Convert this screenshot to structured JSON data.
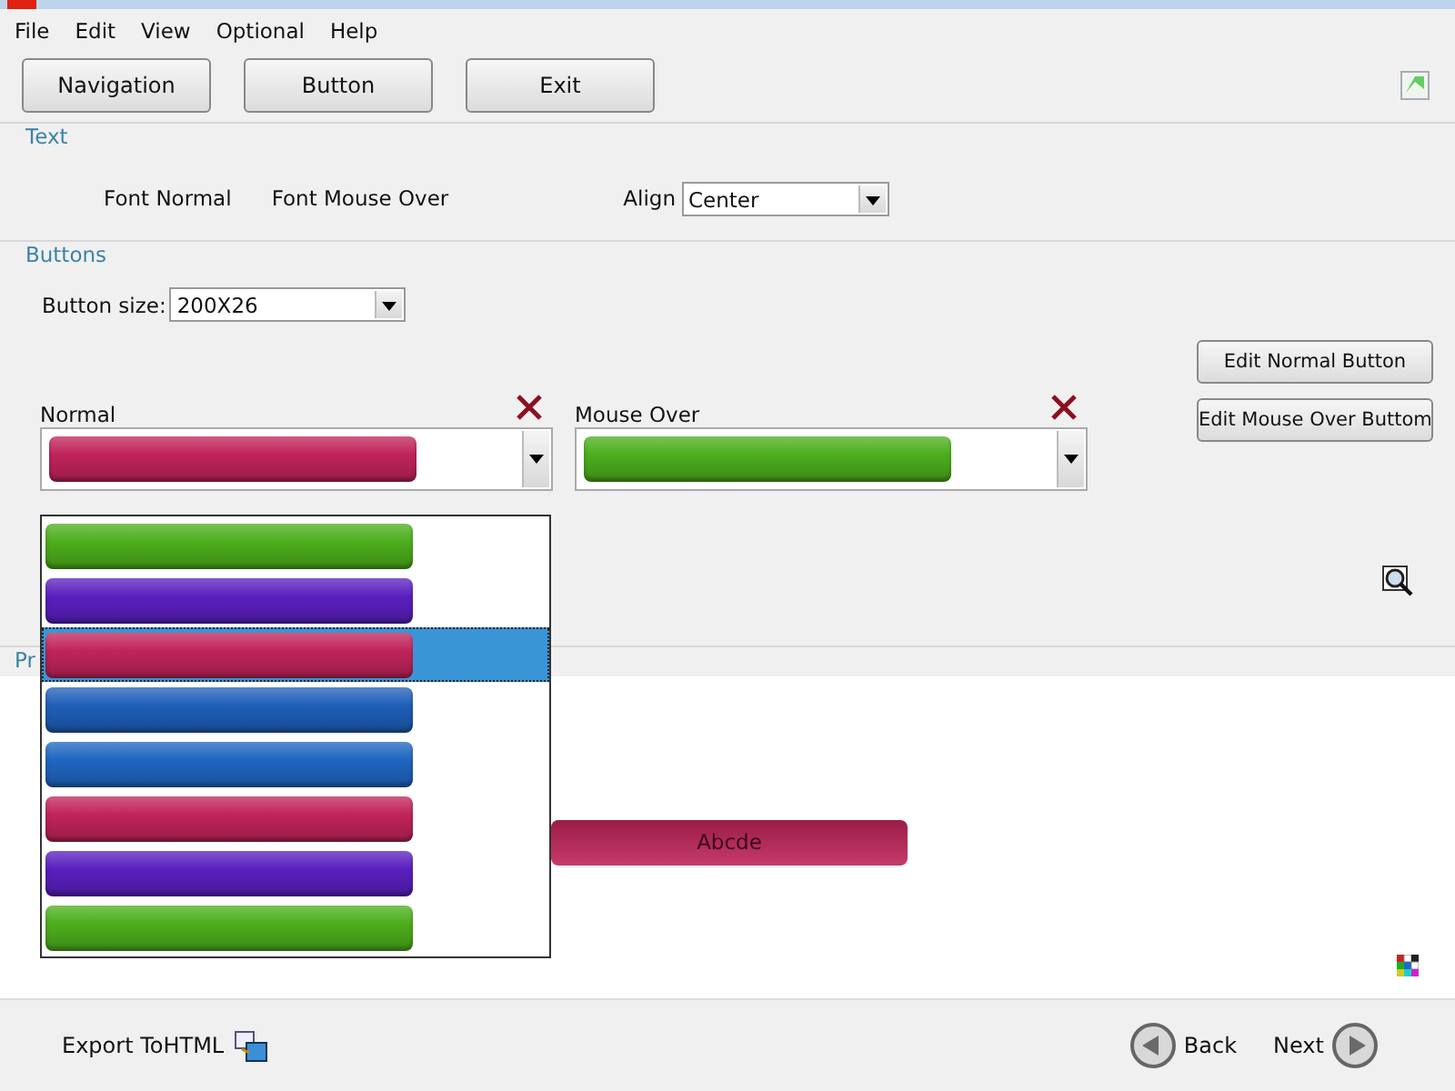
{
  "menu": [
    {
      "label": "File"
    },
    {
      "label": "Edit"
    },
    {
      "label": "View"
    },
    {
      "label": "Optional"
    },
    {
      "label": "Help"
    }
  ],
  "toolbar": [
    {
      "label": "Navigation"
    },
    {
      "label": "Button"
    },
    {
      "label": "Exit"
    }
  ],
  "text_group": {
    "title": "Text",
    "font_normal": "Font Normal",
    "font_mouse_over": "Font Mouse Over",
    "align_label": "Align",
    "align_value": "Center"
  },
  "buttons_group": {
    "title": "Buttons",
    "size_label": "Button size:",
    "size_value": "200X26",
    "normal": {
      "label": "Normal",
      "color": "#c0245a"
    },
    "mouse_over": {
      "label": "Mouse Over",
      "color": "#4cae1c"
    },
    "actions": [
      "Edit Normal Button",
      "Edit Mouse Over Buttom"
    ]
  },
  "style_list": {
    "items": [
      {
        "color": "#4cae1c",
        "selected": false
      },
      {
        "color": "#5a1fbf",
        "selected": false
      },
      {
        "color": "#c0245a",
        "selected": true
      },
      {
        "color": "#1f5fb8",
        "selected": false
      },
      {
        "color": "#1f66c0",
        "selected": false
      },
      {
        "color": "#c0245a",
        "selected": false
      },
      {
        "color": "#5a1fbf",
        "selected": false
      },
      {
        "color": "#4cae1c",
        "selected": false
      }
    ]
  },
  "preview": {
    "title": "Pr",
    "button": {
      "label": "Abcde",
      "color": "#c0245a"
    }
  },
  "footer": {
    "export": "Export ToHTML",
    "back": "Back",
    "next": "Next"
  }
}
